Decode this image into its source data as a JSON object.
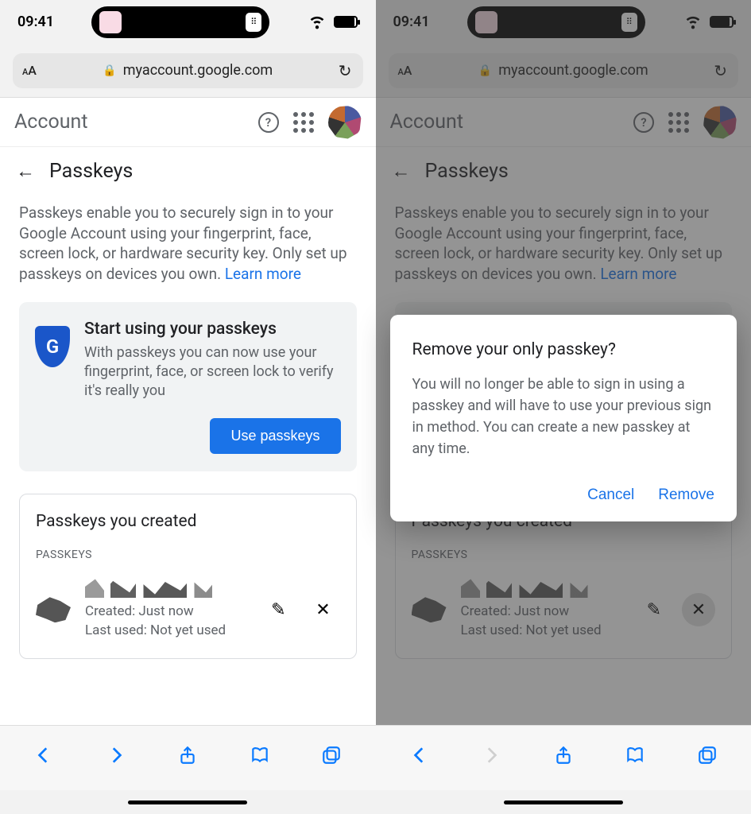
{
  "status": {
    "time": "09:41"
  },
  "urlbar": {
    "host": "myaccount.google.com"
  },
  "header": {
    "title": "Account"
  },
  "page": {
    "title": "Passkeys",
    "intro": "Passkeys enable you to securely sign in to your Google Account using your fingerprint, face, screen lock, or hardware security key. Only set up passkeys on devices you own. ",
    "learn_more": "Learn more"
  },
  "promo": {
    "title": "Start using your passkeys",
    "body": "With passkeys you can now use your fingerprint, face, or screen lock to verify it's really you",
    "cta": "Use passkeys"
  },
  "passkeys_card": {
    "title": "Passkeys you created",
    "group_label": "PASSKEYS",
    "created_label": "Created: Just now",
    "lastused_label": "Last used: Not yet used"
  },
  "modal": {
    "title": "Remove your only passkey?",
    "body": "You will no longer be able to sign in using a passkey and will have to use your previous sign in method. You can create a new passkey at any time.",
    "cancel": "Cancel",
    "confirm": "Remove"
  }
}
